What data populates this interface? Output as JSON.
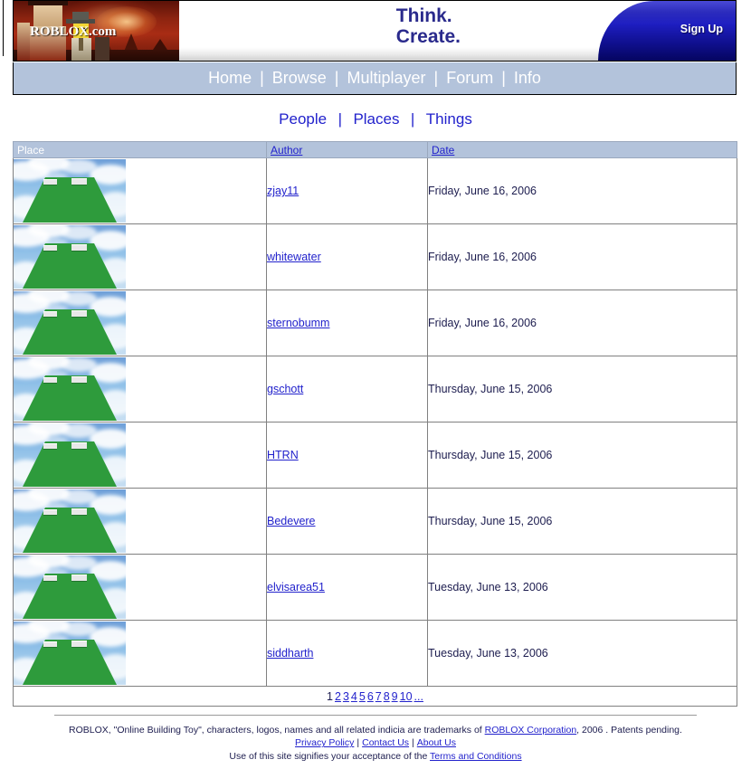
{
  "header": {
    "logo_text": "ROBLOX.com",
    "slogan_line1": "Think.",
    "slogan_line2": "Create.",
    "signup_label": "Sign Up",
    "accent_blue": "#1414a8",
    "nav_bg": "#b3c3db",
    "link_blue": "#2222cc"
  },
  "nav": {
    "items": [
      {
        "label": "Home"
      },
      {
        "label": "Browse"
      },
      {
        "label": "Multiplayer"
      },
      {
        "label": "Forum"
      },
      {
        "label": "Info"
      }
    ],
    "separator": "|"
  },
  "category_tabs": {
    "separator": "|",
    "items": [
      {
        "label": "People"
      },
      {
        "label": "Places"
      },
      {
        "label": "Things"
      }
    ]
  },
  "table": {
    "columns": [
      {
        "label": "Place",
        "is_link": false
      },
      {
        "label": "Author",
        "is_link": true
      },
      {
        "label": "Date",
        "is_link": true
      }
    ],
    "rows": [
      {
        "thumbnail": "place-thumbnail",
        "author": "zjay11",
        "date": "Friday, June 16, 2006"
      },
      {
        "thumbnail": "place-thumbnail",
        "author": "whitewater",
        "date": "Friday, June 16, 2006"
      },
      {
        "thumbnail": "place-thumbnail",
        "author": "sternobumm",
        "date": "Friday, June 16, 2006"
      },
      {
        "thumbnail": "place-thumbnail",
        "author": "gschott",
        "date": "Thursday, June 15, 2006"
      },
      {
        "thumbnail": "place-thumbnail",
        "author": "HTRN",
        "date": "Thursday, June 15, 2006"
      },
      {
        "thumbnail": "place-thumbnail",
        "author": "Bedevere",
        "date": "Thursday, June 15, 2006"
      },
      {
        "thumbnail": "place-thumbnail",
        "author": "elvisarea51",
        "date": "Tuesday, June 13, 2006"
      },
      {
        "thumbnail": "place-thumbnail",
        "author": "siddharth",
        "date": "Tuesday, June 13, 2006"
      }
    ]
  },
  "pagination": {
    "current": "1",
    "pages": [
      "2",
      "3",
      "4",
      "5",
      "6",
      "7",
      "8",
      "9",
      "10"
    ],
    "more": "..."
  },
  "footer": {
    "line1_part1": "ROBLOX, \"Online Building Toy\", characters, logos, names and all related indicia are trademarks of ",
    "line1_link": "ROBLOX Corporation",
    "line1_part2": ", 2006 . Patents pending.",
    "links": [
      {
        "label": "Privacy Policy"
      },
      {
        "label": "Contact Us"
      },
      {
        "label": "About Us"
      }
    ],
    "link_separator": "|",
    "line3_prefix": "Use of this site signifies your acceptance of the ",
    "line3_link": "Terms and Conditions"
  }
}
